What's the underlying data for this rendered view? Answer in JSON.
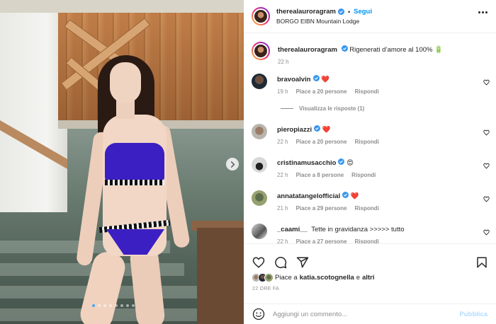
{
  "post": {
    "author": "therealauroragram",
    "follow_label": "Segui",
    "separator": "•",
    "location": "BORGO EIBN Mountain Lodge",
    "caption_text": "Rigenerati d’amore al 100% 🔋",
    "caption_time": "22 h",
    "carousel_dots": 8,
    "active_dot": 0
  },
  "comments": [
    {
      "username": "bravoalvin",
      "verified": true,
      "text": "❤️",
      "time": "19 h",
      "likes": "Piace a 20 persone",
      "reply": "Rispondi"
    },
    {
      "username": "pieropiazzi",
      "verified": true,
      "text": "❤️",
      "time": "22 h",
      "likes": "Piace a 20 persone",
      "reply": "Rispondi"
    },
    {
      "username": "cristinamusacchio",
      "verified": true,
      "text": "😍",
      "time": "22 h",
      "likes": "Piace a 8 persone",
      "reply": "Rispondi"
    },
    {
      "username": "annatatangelofficial",
      "verified": true,
      "text": "❤️",
      "time": "21 h",
      "likes": "Piace a 29 persone",
      "reply": "Rispondi"
    },
    {
      "username": "_caami__",
      "verified": false,
      "text": "Tette in gravidanza >>>>> tutto",
      "time": "22 h",
      "likes": "Piace a 27 persone",
      "reply": "Rispondi"
    }
  ],
  "view_replies": "Visualizza le risposte (1)",
  "likes_summary": {
    "prefix": "Piace a",
    "user": "katia.scotognella",
    "conj": "e",
    "others": "altri"
  },
  "time_ago": "22 ORE FA",
  "composer": {
    "placeholder": "Aggiungi un commento...",
    "publish_label": "Pubblica"
  },
  "colors": {
    "accent": "#0095f6",
    "verified": "#3897f0",
    "heart": "#ed4956",
    "muted": "#8e8e8e",
    "publish_disabled": "#b3dbff"
  },
  "icons": [
    "heart-icon",
    "comment-icon",
    "share-icon",
    "bookmark-icon",
    "emoji-icon",
    "more-icon",
    "chevron-right-icon",
    "verified-icon"
  ]
}
